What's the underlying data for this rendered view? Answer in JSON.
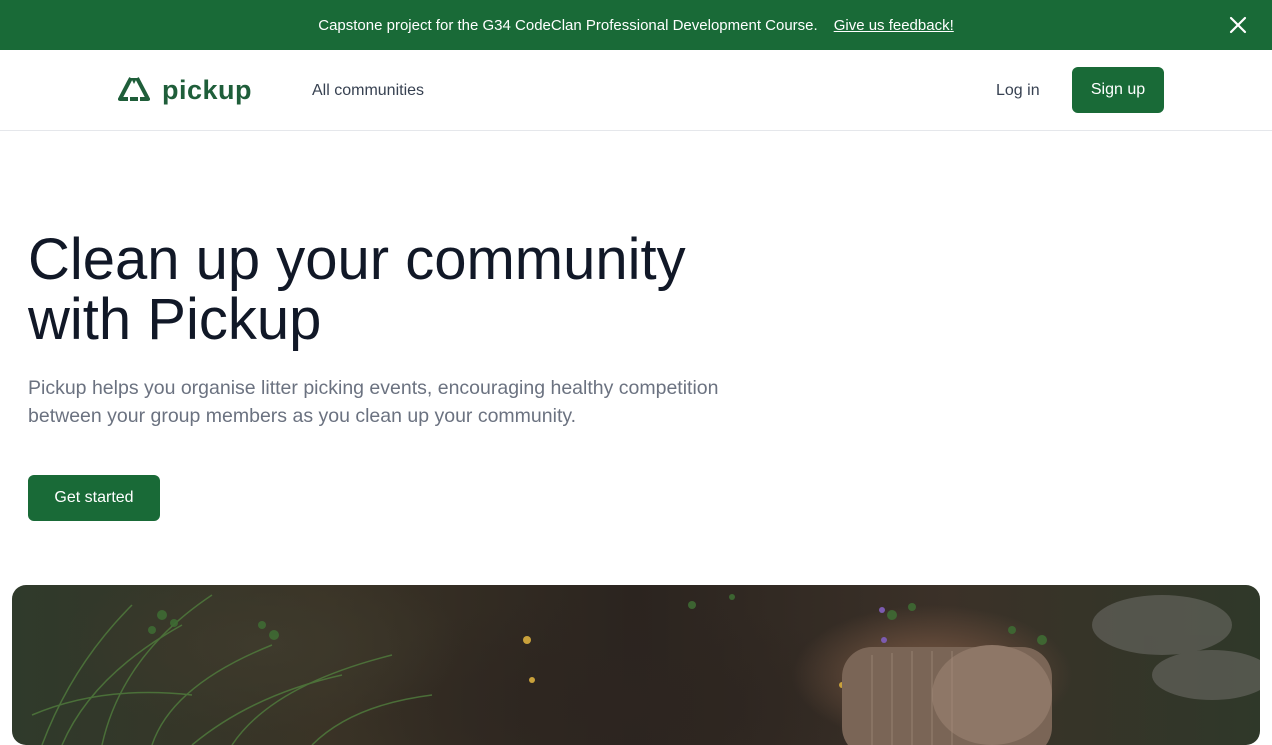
{
  "banner": {
    "text": "Capstone project for the G34 CodeClan Professional Development Course.",
    "link": "Give us feedback!",
    "close_icon": "close-icon"
  },
  "nav": {
    "logo_text": "pickup",
    "logo_icon": "recycle-triangle-icon",
    "all_communities": "All communities",
    "login": "Log in",
    "signup": "Sign up"
  },
  "hero": {
    "title_line1": "Clean up your community",
    "title_line2": "with Pickup",
    "subtitle_line1": "Pickup helps you organise litter picking events, encouraging healthy competition",
    "subtitle_line2": "between your group members as you clean up your community.",
    "cta": "Get started",
    "image": "litter-in-undergrowth-photo"
  },
  "colors": {
    "brand_green": "#196a37",
    "logo_green": "#1f5e3a",
    "title": "#111827",
    "subtitle": "#6b7280"
  }
}
